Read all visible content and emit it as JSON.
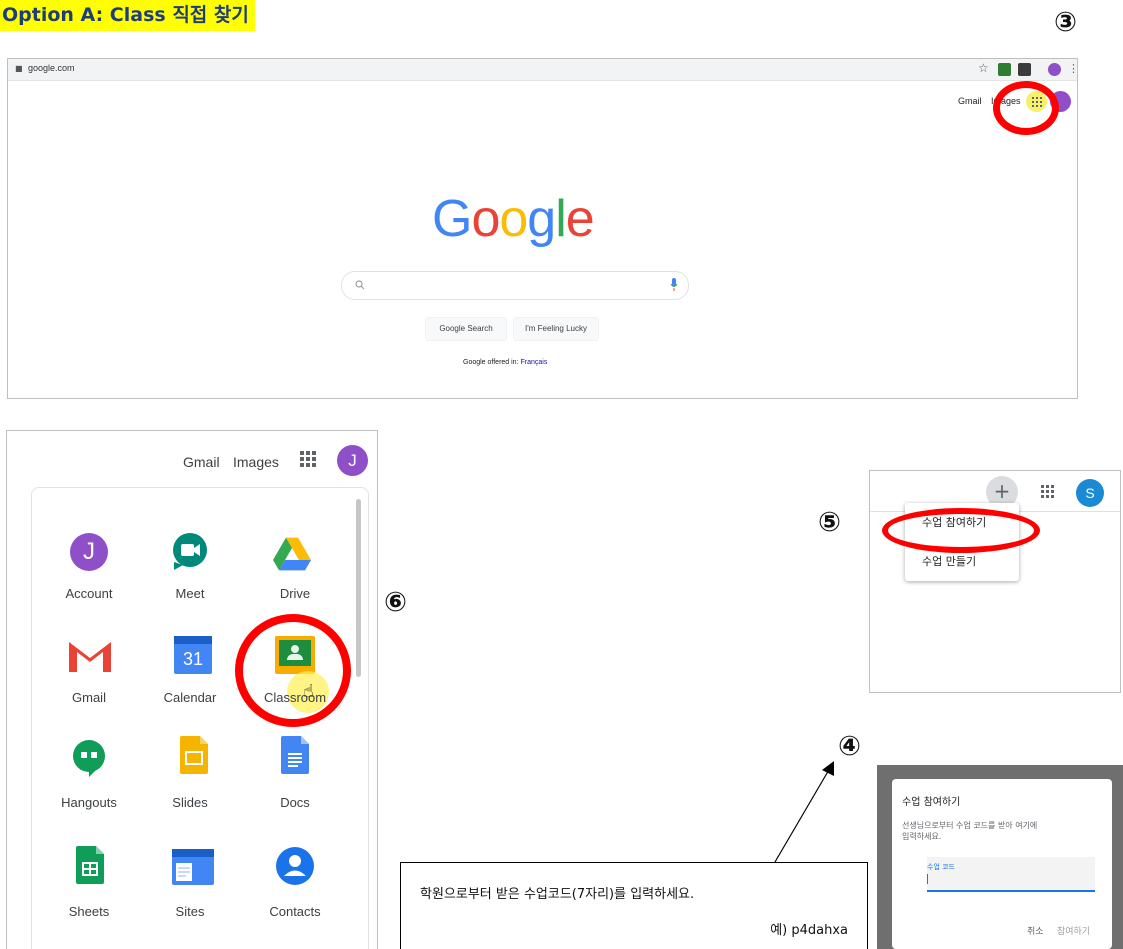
{
  "heading": "Option A: Class 직접 찾기",
  "step_numbers": {
    "s3": "③",
    "s4": "④",
    "s5": "⑤",
    "s6": "⑥"
  },
  "browser": {
    "url": "google.com",
    "top_links": {
      "gmail": "Gmail",
      "images": "Images"
    },
    "logo_letters": [
      {
        "ch": "G",
        "color": "#4285f4"
      },
      {
        "ch": "o",
        "color": "#ea4335"
      },
      {
        "ch": "o",
        "color": "#fbbc05"
      },
      {
        "ch": "g",
        "color": "#4285f4"
      },
      {
        "ch": "l",
        "color": "#34a853"
      },
      {
        "ch": "e",
        "color": "#ea4335"
      }
    ],
    "search_button": "Google Search",
    "lucky_button": "I'm Feeling Lucky",
    "offered_in": "Google offered in:",
    "offered_lang": "Français"
  },
  "apps_launcher": {
    "top_links": {
      "gmail": "Gmail",
      "images": "Images"
    },
    "avatar_letter": "J",
    "apps": [
      {
        "label": "Account"
      },
      {
        "label": "Meet"
      },
      {
        "label": "Drive"
      },
      {
        "label": "Gmail"
      },
      {
        "label": "Calendar"
      },
      {
        "label": "Classroom"
      },
      {
        "label": "Hangouts"
      },
      {
        "label": "Slides"
      },
      {
        "label": "Docs"
      },
      {
        "label": "Sheets"
      },
      {
        "label": "Sites"
      },
      {
        "label": "Contacts"
      }
    ],
    "calendar_day": "31",
    "account_letter": "J"
  },
  "classroom_menu": {
    "avatar_letter": "S",
    "items": [
      "수업 참여하기",
      "수업 만들기"
    ]
  },
  "join_dialog": {
    "title": "수업 참여하기",
    "description_line1": "선생님으로부터 수업 코드를 받아 여기에",
    "description_line2": "입력하세요.",
    "field_label": "수업 코드",
    "cancel": "취소",
    "join": "참여하기"
  },
  "instruction": {
    "line1": "학원으로부터 받은 수업코드(7자리)를 입력하세요.",
    "line2": "예) p4dahxa"
  },
  "colors": {
    "highlight": "#ffff00",
    "ring": "#ff0000",
    "google_blue": "#1a73e8"
  }
}
